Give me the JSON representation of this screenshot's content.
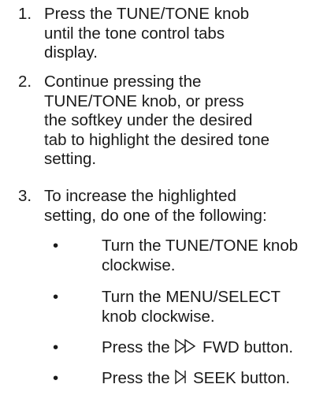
{
  "steps": [
    {
      "number": "1.",
      "lines": [
        "Press the TUNE/TONE knob",
        "until the tone control tabs",
        "display."
      ]
    },
    {
      "number": "2.",
      "lines": [
        "Continue pressing the",
        "TUNE/TONE knob, or press",
        "the softkey under the desired",
        "tab to highlight the desired tone",
        "setting."
      ]
    },
    {
      "number": "3.",
      "lines": [
        "To increase the highlighted",
        "setting, do one of the following:"
      ]
    }
  ],
  "bullets": [
    {
      "marker": "•",
      "lines": [
        "Turn the TUNE/TONE knob",
        "clockwise."
      ]
    },
    {
      "marker": "•",
      "lines": [
        "Turn the MENU/SELECT",
        "knob clockwise."
      ]
    },
    {
      "marker": "•",
      "prefix": "Press the ",
      "icon": "fast-forward-icon",
      "suffix": " FWD button."
    },
    {
      "marker": "•",
      "prefix": "Press the ",
      "icon": "seek-forward-icon",
      "suffix": " SEEK button."
    }
  ]
}
